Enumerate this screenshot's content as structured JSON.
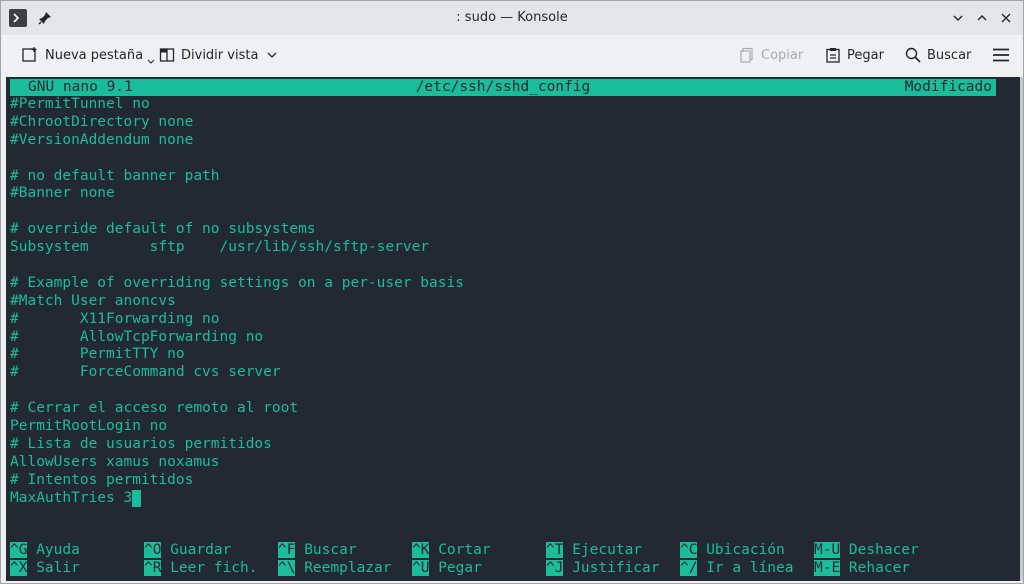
{
  "window": {
    "title": ": sudo — Konsole",
    "controls": [
      "chevron-down-icon",
      "chevron-up-icon",
      "close-icon"
    ]
  },
  "toolbar": {
    "new_tab_label": "Nueva pestaña",
    "split_view_label": "Dividir vista",
    "copy_label": "Copiar",
    "paste_label": "Pegar",
    "search_label": "Buscar"
  },
  "nano": {
    "header": {
      "app": "GNU nano 9.1",
      "file": "/etc/ssh/sshd_config",
      "status": "Modificado"
    },
    "lines": [
      "#PermitTunnel no",
      "#ChrootDirectory none",
      "#VersionAddendum none",
      "",
      "# no default banner path",
      "#Banner none",
      "",
      "# override default of no subsystems",
      "Subsystem       sftp    /usr/lib/ssh/sftp-server",
      "",
      "# Example of overriding settings on a per-user basis",
      "#Match User anoncvs",
      "#       X11Forwarding no",
      "#       AllowTcpForwarding no",
      "#       PermitTTY no",
      "#       ForceCommand cvs server",
      "",
      "# Cerrar el acceso remoto al root",
      "PermitRootLogin no",
      "# Lista de usuarios permitidos",
      "AllowUsers xamus noxamus",
      "# Intentos permitidos",
      "MaxAuthTries 3"
    ],
    "shortcuts": [
      [
        {
          "key": "^G",
          "label": "Ayuda"
        },
        {
          "key": "^O",
          "label": "Guardar"
        },
        {
          "key": "^F",
          "label": "Buscar"
        },
        {
          "key": "^K",
          "label": "Cortar"
        },
        {
          "key": "^T",
          "label": "Ejecutar"
        },
        {
          "key": "^C",
          "label": "Ubicación"
        },
        {
          "key": "M-U",
          "label": "Deshacer"
        }
      ],
      [
        {
          "key": "^X",
          "label": "Salir"
        },
        {
          "key": "^R",
          "label": "Leer fich."
        },
        {
          "key": "^\\",
          "label": "Reemplazar"
        },
        {
          "key": "^U",
          "label": "Pegar"
        },
        {
          "key": "^J",
          "label": "Justificar"
        },
        {
          "key": "^/",
          "label": "Ir a línea"
        },
        {
          "key": "M-E",
          "label": "Rehacer"
        }
      ]
    ]
  },
  "colors": {
    "terminal_bg": "#232932",
    "terminal_fg": "#1abc9c"
  }
}
